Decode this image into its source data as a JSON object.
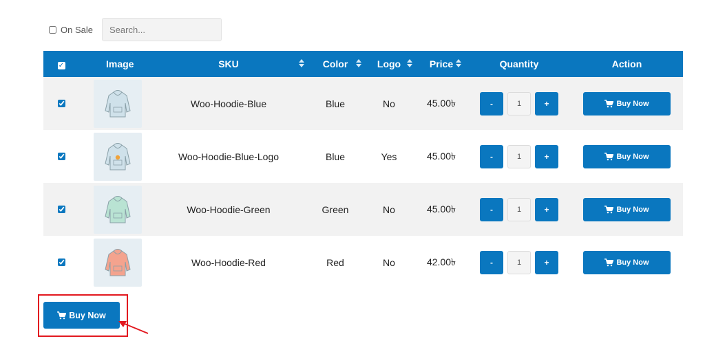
{
  "filter": {
    "on_sale_label": "On Sale",
    "on_sale_checked": false,
    "search_placeholder": "Search..."
  },
  "table": {
    "headers": {
      "image": "Image",
      "sku": "SKU",
      "color": "Color",
      "logo": "Logo",
      "price": "Price",
      "quantity": "Quantity",
      "action": "Action"
    },
    "header_select_all_glyph": "✓",
    "rows": [
      {
        "sku": "Woo-Hoodie-Blue",
        "color": "Blue",
        "logo": "No",
        "price": "45.00৳",
        "quantity": "1",
        "buy_label": "Buy Now",
        "hoodie_color": "#cfe1ea",
        "has_logo": false
      },
      {
        "sku": "Woo-Hoodie-Blue-Logo",
        "color": "Blue",
        "logo": "Yes",
        "price": "45.00৳",
        "quantity": "1",
        "buy_label": "Buy Now",
        "hoodie_color": "#cfe1ea",
        "has_logo": true
      },
      {
        "sku": "Woo-Hoodie-Green",
        "color": "Green",
        "logo": "No",
        "price": "45.00৳",
        "quantity": "1",
        "buy_label": "Buy Now",
        "hoodie_color": "#b9e3d3",
        "has_logo": false
      },
      {
        "sku": "Woo-Hoodie-Red",
        "color": "Red",
        "logo": "No",
        "price": "42.00৳",
        "quantity": "1",
        "buy_label": "Buy Now",
        "hoodie_color": "#f4a38e",
        "has_logo": false
      }
    ],
    "qty_minus": "-",
    "qty_plus": "+"
  },
  "bulk": {
    "buy_label": "Buy Now"
  },
  "colors": {
    "accent": "#0a77bf",
    "row_alt": "#f2f2f2",
    "highlight": "#e2181f"
  },
  "icons": {
    "cart": "cart-icon",
    "sort": "sort-arrows-icon",
    "hoodie": "hoodie-icon"
  }
}
